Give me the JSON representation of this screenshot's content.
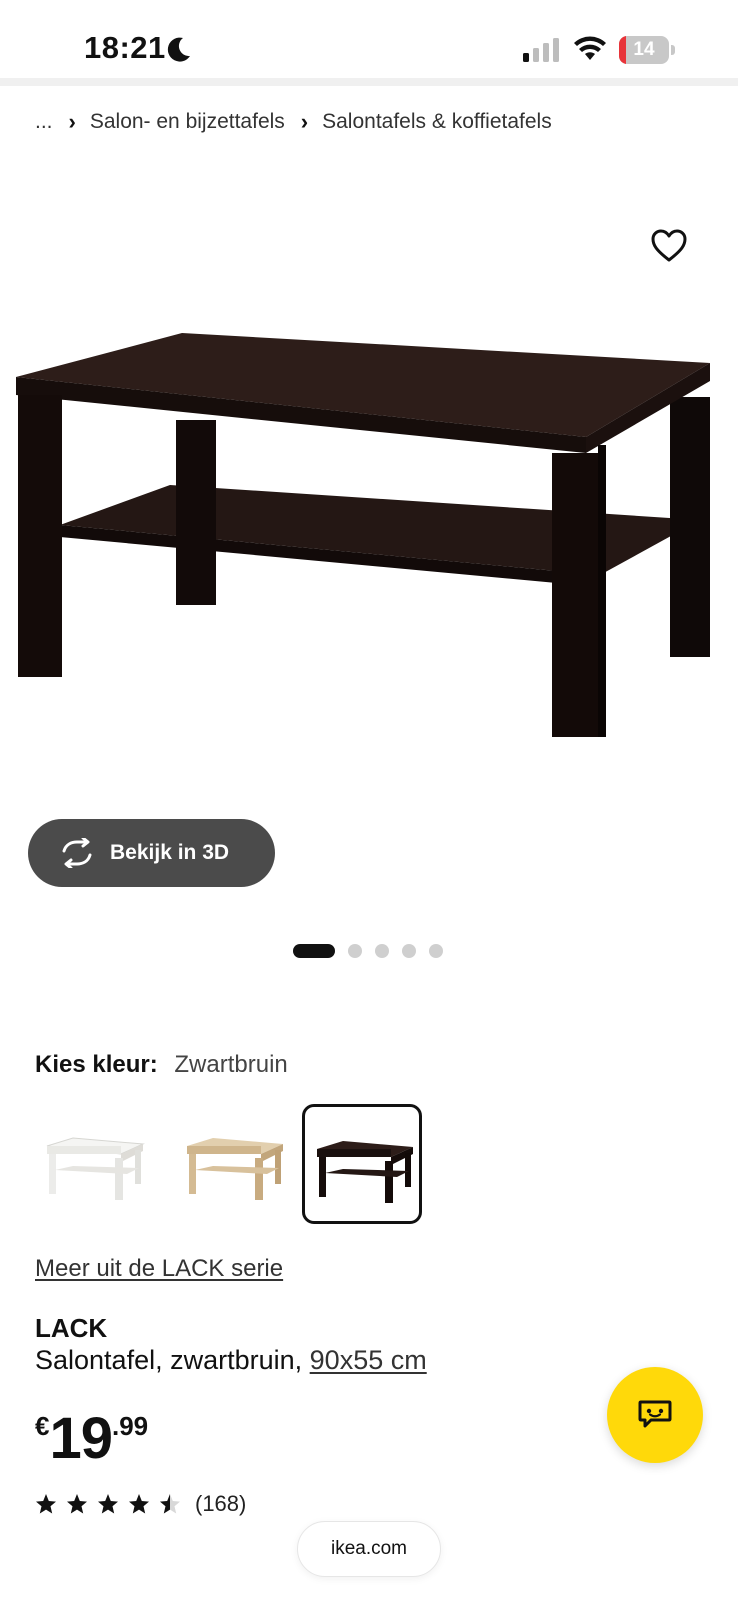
{
  "status_bar": {
    "time": "18:21",
    "battery_level": 14,
    "battery_text": "14",
    "icons": [
      "moon-icon",
      "cellular-signal-icon",
      "wifi-icon",
      "battery-charging-icon"
    ]
  },
  "breadcrumb": {
    "items": [
      "...",
      "Salon- en bijzettafels",
      "Salontafels & koffietafels"
    ],
    "separator_icon": "chevron-right-icon"
  },
  "favorite_icon": "heart-outline-icon",
  "view_3d": {
    "label": "Bekijk in 3D",
    "icon": "rotate-3d-icon"
  },
  "carousel": {
    "total": 5,
    "active_index": 0
  },
  "color_chooser": {
    "label": "Kies kleur:",
    "selected": "Zwartbruin",
    "options": [
      {
        "color": "#f4f4f2",
        "selected": false
      },
      {
        "color": "#d9c3a2",
        "selected": false
      },
      {
        "color": "#2a1b18",
        "selected": true
      }
    ]
  },
  "series_link": "Meer uit de LACK serie",
  "product": {
    "name": "LACK",
    "description": "Salontafel, zwartbruin,",
    "size": "90x55 cm",
    "price": {
      "currency": "€",
      "integer": "19",
      "decimal": ".99"
    },
    "rating": {
      "stars": 4.5,
      "count": "(168)"
    }
  },
  "chat_icon": "chat-bubble-icon",
  "url": "ikea.com",
  "colors": {
    "accent_yellow": "#ffd90a",
    "button_dark": "#4b4b4b",
    "table_dark": "#2a1b18"
  }
}
